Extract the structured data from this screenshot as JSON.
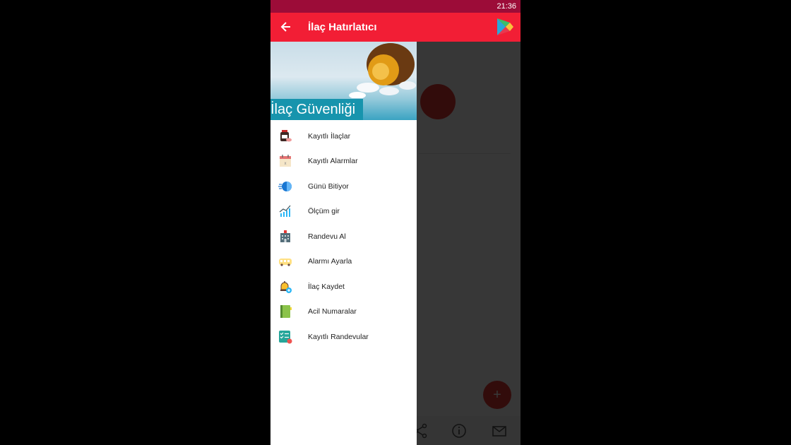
{
  "status_bar": {
    "time": "21:36"
  },
  "app_bar": {
    "title": "İlaç Hatırlatıcı"
  },
  "drawer": {
    "header_title": "İlaç Güvenliği",
    "items": [
      {
        "label": "Kayıtlı İlaçlar",
        "icon": "medicine-bottle-icon"
      },
      {
        "label": "Kayıtlı Alarmlar",
        "icon": "calendar-icon"
      },
      {
        "label": "Günü Bitiyor",
        "icon": "running-clock-icon"
      },
      {
        "label": "Ölçüm gir",
        "icon": "growth-chart-icon"
      },
      {
        "label": "Randevu Al",
        "icon": "hospital-icon"
      },
      {
        "label": "Alarmı Ayarla",
        "icon": "alarm-bus-icon"
      },
      {
        "label": "İlaç Kaydet",
        "icon": "bell-add-icon"
      },
      {
        "label": "Acil Numaralar",
        "icon": "phone-book-icon"
      },
      {
        "label": "Kayıtlı Randevular",
        "icon": "checklist-icon"
      }
    ]
  },
  "colors": {
    "status_bar": "#9c0c38",
    "app_bar": "#f21e35",
    "banner": "#1794ad"
  }
}
